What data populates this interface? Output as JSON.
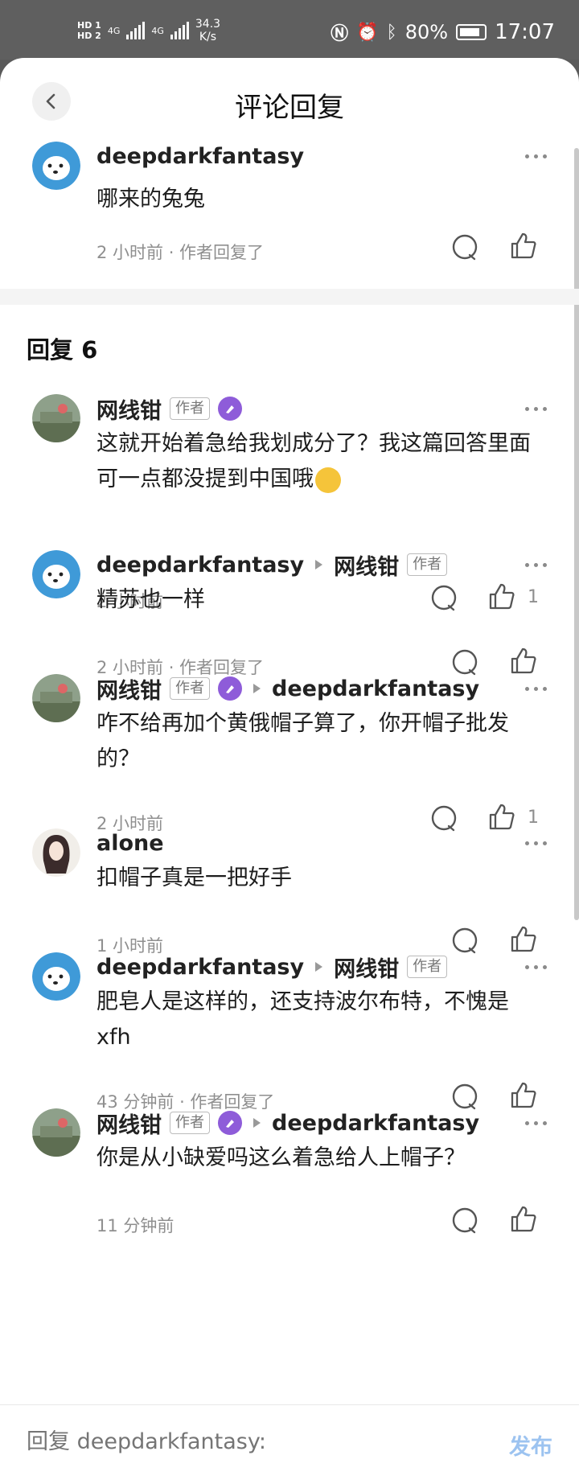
{
  "status_bar": {
    "hd1": "HD 1",
    "hd2": "HD 2",
    "net1": "4G",
    "net2": "4G",
    "speed": "34.3",
    "speed_unit": "K/s",
    "battery": "80%",
    "time": "17:07"
  },
  "header": {
    "title": "评论回复"
  },
  "parent_comment": {
    "user": "deepdarkfantasy",
    "text": "哪来的兔兔",
    "meta": "2 小时前 · 作者回复了"
  },
  "replies_header": "回复 6",
  "author_tag": "作者",
  "replies": [
    {
      "user": "网线钳",
      "text": "这就开始着急给我划成分了？我这篇回答里面可一点都没提到中国哦",
      "meta": "2 小时前",
      "likes": "1"
    },
    {
      "user": "deepdarkfantasy",
      "to": "网线钳",
      "text": "精苏也一样",
      "meta": "2 小时前 · 作者回复了"
    },
    {
      "user": "网线钳",
      "to": "deepdarkfantasy",
      "text": "咋不给再加个黄俄帽子算了，你开帽子批发的？",
      "meta": "2 小时前",
      "likes": "1"
    },
    {
      "user": "alone",
      "text": "扣帽子真是一把好手",
      "meta": "1 小时前"
    },
    {
      "user": "deepdarkfantasy",
      "to": "网线钳",
      "text": "肥皂人是这样的，还支持波尔布特，不愧是xfh",
      "meta": "43 分钟前 · 作者回复了"
    },
    {
      "user": "网线钳",
      "to": "deepdarkfantasy",
      "text": "你是从小缺爱吗这么着急给人上帽子？",
      "meta": "11 分钟前"
    }
  ],
  "bottom": {
    "placeholder": "回复 deepdarkfantasy:",
    "publish": "发布"
  },
  "colors": {
    "accent_disabled": "#9cc3f0",
    "badge_purple": "#8e5cd9",
    "avatar_blue": "#3f9ad8"
  }
}
